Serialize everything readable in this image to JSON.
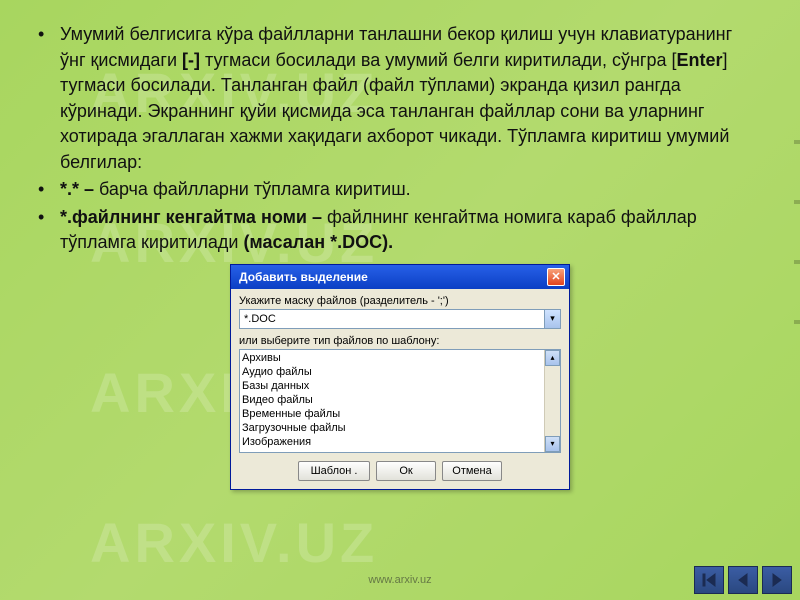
{
  "bullets": [
    {
      "pre": "Умумий белгисига кўра файлларни танлашни бекор қилиш учун клавиатуранинг ўнг қисмидаги ",
      "key1": "[-]",
      "mid": " тугмаси босилади ва умумий белги киритилади, сўнгра [",
      "key2": "Enter",
      "post": "] тугмаси босилади. Танланган файл (файл тўплами) экранда қизил рангда кўринади. Экраннинг қуйи қисмида эса танланган файллар сони ва уларнинг хотирада эгаллаган хажми хақидаги ахборот чикади.  Тўпламга киритиш умумий белгилар:"
    },
    {
      "pre": "",
      "key1": "*.* –",
      "mid": " барча файлларни тўпламга киритиш.",
      "key2": "",
      "post": ""
    },
    {
      "pre": "",
      "key1": "*.файлнинг кенгайтма номи –",
      "mid": " файлнинг кенгайтма номига караб файллар тўпламга киритилади ",
      "key2": "(масалан *.DOC).",
      "post": ""
    }
  ],
  "dialog": {
    "title": "Добавить выделение",
    "label1": "Укажите маску файлов (разделитель - ';')",
    "input_value": "*.DOC",
    "label2": "или выберите тип файлов по шаблону:",
    "list": [
      "Архивы",
      "Аудио файлы",
      "Базы данных",
      "Видео файлы",
      "Временные файлы",
      "Загрузочные файлы",
      "Изображения"
    ],
    "btn_template": "Шаблон .",
    "btn_ok": "Ок",
    "btn_cancel": "Отмена"
  },
  "footer_link": "www.arxiv.uz",
  "watermark": "ARXIV.UZ"
}
